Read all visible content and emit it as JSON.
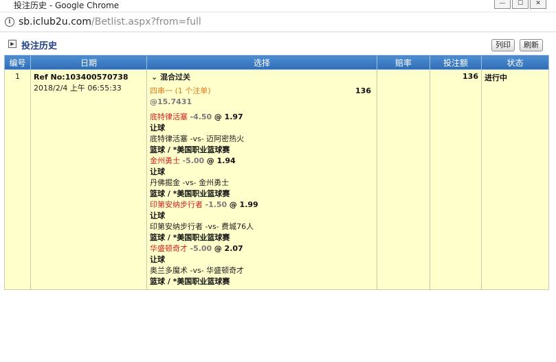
{
  "window": {
    "title": "投注历史 - Google Chrome",
    "minimize": "—",
    "maximize": "☐",
    "close": "✕"
  },
  "address": {
    "host": "sb.iclub2u.com",
    "path": "/Betlist.aspx?from=full"
  },
  "page": {
    "title": "投注历史",
    "print_label": "列印",
    "refresh_label": "刷新"
  },
  "table": {
    "headers": [
      "编号",
      "日期",
      "选择",
      "赔率",
      "投注额",
      "状态"
    ],
    "row": {
      "index": "1",
      "ref": "Ref No:103400570738",
      "datetime": "2018/2/4 上午 06:55:33",
      "type": "混合过关",
      "combo": "四串一 (1 个注单)",
      "combo_amount": "136",
      "combo_odds": "@15.7431",
      "stake": "136",
      "status": "进行中",
      "legs": [
        {
          "team": "底特律活塞",
          "handicap": "-4.50",
          "odds": "@ 1.97",
          "bet_type": "让球",
          "match": "底特律活塞 -vs- 迈阿密热火",
          "league": "篮球 / *美国职业篮球赛"
        },
        {
          "team": "金州勇士",
          "handicap": "-5.00",
          "odds": "@ 1.94",
          "bet_type": "让球",
          "match": "丹佛掘金 -vs- 金州勇士",
          "league": "篮球 / *美国职业篮球赛"
        },
        {
          "team": "印第安纳步行者",
          "handicap": "-1.50",
          "odds": "@ 1.99",
          "bet_type": "让球",
          "match": "印第安纳步行者 -vs- 费城76人",
          "league": "篮球 / *美国职业篮球赛"
        },
        {
          "team": "华盛顿奇才",
          "handicap": "-5.00",
          "odds": "@ 2.07",
          "bet_type": "让球",
          "match": "奥兰多魔术 -vs- 华盛顿奇才",
          "league": "篮球 / *美国职业篮球赛"
        }
      ]
    }
  }
}
